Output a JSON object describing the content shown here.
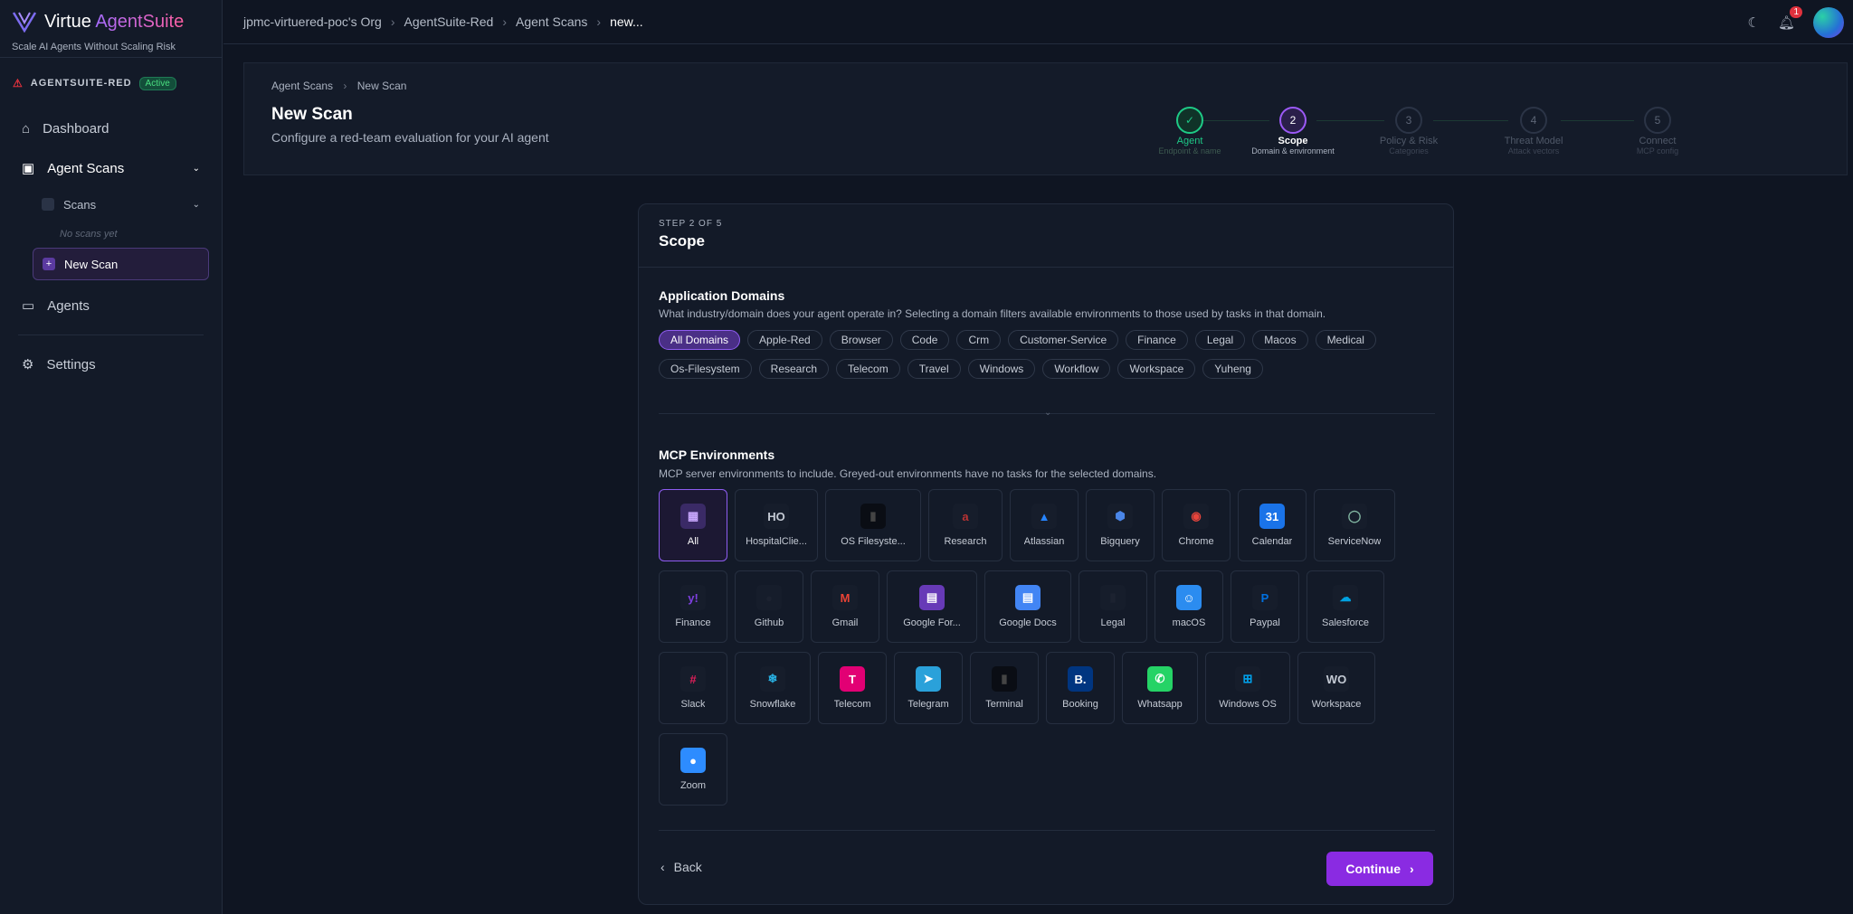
{
  "sidebar": {
    "brand_prefix": "Virtue ",
    "brand_suffix": "AgentSuite",
    "tagline": "Scale AI Agents Without Scaling Risk",
    "org_name": "AGENTSUITE-RED",
    "org_status": "Active",
    "nav": {
      "dashboard": "Dashboard",
      "agent_scans": "Agent Scans",
      "scans": "Scans",
      "no_scans": "No scans yet",
      "new_scan": "New Scan",
      "agents": "Agents",
      "settings": "Settings"
    }
  },
  "topbar": {
    "breadcrumbs": [
      "jpmc-virtuered-poc's Org",
      "AgentSuite-Red",
      "Agent Scans",
      "new..."
    ],
    "notification_count": "1"
  },
  "header": {
    "breadcrumb_parent": "Agent Scans",
    "breadcrumb_current": "New Scan",
    "title": "New Scan",
    "subtitle": "Configure a red-team evaluation for your AI agent",
    "steps": [
      {
        "num": "✓",
        "title": "Agent",
        "sub": "Endpoint & name"
      },
      {
        "num": "2",
        "title": "Scope",
        "sub": "Domain & environment"
      },
      {
        "num": "3",
        "title": "Policy & Risk",
        "sub": "Categories"
      },
      {
        "num": "4",
        "title": "Threat Model",
        "sub": "Attack vectors"
      },
      {
        "num": "5",
        "title": "Connect",
        "sub": "MCP config"
      }
    ]
  },
  "card": {
    "step_label": "STEP 2 OF 5",
    "title": "Scope",
    "domains_title": "Application Domains",
    "domains_desc": "What industry/domain does your agent operate in? Selecting a domain filters available environments to those used by tasks in that domain.",
    "domains": [
      "All Domains",
      "Apple-Red",
      "Browser",
      "Code",
      "Crm",
      "Customer-Service",
      "Finance",
      "Legal",
      "Macos",
      "Medical",
      "Os-Filesystem",
      "Research",
      "Telecom",
      "Travel",
      "Windows",
      "Workflow",
      "Workspace",
      "Yuheng"
    ],
    "env_title": "MCP Environments",
    "env_desc": "MCP server environments to include. Greyed-out environments have no tasks for the selected domains.",
    "environments": [
      {
        "label": "All",
        "icon": "grid-icon",
        "glyph": "▦",
        "bg": "#3a2a66",
        "fg": "#c9a8ff"
      },
      {
        "label": "HospitalClie...",
        "icon": "hospital-icon",
        "glyph": "HO",
        "bg": "#161d2b",
        "fg": "#c4cad4"
      },
      {
        "label": "OS Filesyste...",
        "icon": "terminal-icon",
        "glyph": "▮",
        "bg": "#0a0d14",
        "fg": "#444"
      },
      {
        "label": "Research",
        "icon": "arxiv-icon",
        "glyph": "a",
        "bg": "#161d2b",
        "fg": "#b33"
      },
      {
        "label": "Atlassian",
        "icon": "atlassian-icon",
        "glyph": "▲",
        "bg": "#161d2b",
        "fg": "#2684ff"
      },
      {
        "label": "Bigquery",
        "icon": "bigquery-icon",
        "glyph": "⬢",
        "bg": "#161d2b",
        "fg": "#4a86e8"
      },
      {
        "label": "Chrome",
        "icon": "chrome-icon",
        "glyph": "◉",
        "bg": "#161d2b",
        "fg": "#e8453c"
      },
      {
        "label": "Calendar",
        "icon": "calendar-icon",
        "glyph": "31",
        "bg": "#1a73e8",
        "fg": "#fff"
      },
      {
        "label": "ServiceNow",
        "icon": "servicenow-icon",
        "glyph": "◯",
        "bg": "#161d2b",
        "fg": "#81b5a1"
      },
      {
        "label": "Finance",
        "icon": "yahoo-icon",
        "glyph": "y!",
        "bg": "#161d2b",
        "fg": "#7e3fe0"
      },
      {
        "label": "Github",
        "icon": "github-icon",
        "glyph": "●",
        "bg": "#161d2b",
        "fg": "#1c2230"
      },
      {
        "label": "Gmail",
        "icon": "gmail-icon",
        "glyph": "M",
        "bg": "#161d2b",
        "fg": "#ea4335"
      },
      {
        "label": "Google For...",
        "icon": "google-forms-icon",
        "glyph": "▤",
        "bg": "#673ab7",
        "fg": "#fff"
      },
      {
        "label": "Google Docs",
        "icon": "google-docs-icon",
        "glyph": "▤",
        "bg": "#4285f4",
        "fg": "#fff"
      },
      {
        "label": "Legal",
        "icon": "legal-icon",
        "glyph": "▮",
        "bg": "#161d2b",
        "fg": "#1c2230"
      },
      {
        "label": "macOS",
        "icon": "finder-icon",
        "glyph": "☺",
        "bg": "#2b8cf0",
        "fg": "#fff"
      },
      {
        "label": "Paypal",
        "icon": "paypal-icon",
        "glyph": "P",
        "bg": "#161d2b",
        "fg": "#0070e0"
      },
      {
        "label": "Salesforce",
        "icon": "salesforce-icon",
        "glyph": "☁",
        "bg": "#161d2b",
        "fg": "#00a1e0"
      },
      {
        "label": "Slack",
        "icon": "slack-icon",
        "glyph": "#",
        "bg": "#161d2b",
        "fg": "#e01e5a"
      },
      {
        "label": "Snowflake",
        "icon": "snowflake-icon",
        "glyph": "❄",
        "bg": "#161d2b",
        "fg": "#29b5e8"
      },
      {
        "label": "Telecom",
        "icon": "tmobile-icon",
        "glyph": "T",
        "bg": "#e20074",
        "fg": "#fff"
      },
      {
        "label": "Telegram",
        "icon": "telegram-icon",
        "glyph": "➤",
        "bg": "#2aa1da",
        "fg": "#fff"
      },
      {
        "label": "Terminal",
        "icon": "terminal-icon",
        "glyph": "▮",
        "bg": "#0a0d14",
        "fg": "#444"
      },
      {
        "label": "Booking",
        "icon": "booking-icon",
        "glyph": "B.",
        "bg": "#003580",
        "fg": "#fff"
      },
      {
        "label": "Whatsapp",
        "icon": "whatsapp-icon",
        "glyph": "✆",
        "bg": "#25d366",
        "fg": "#fff"
      },
      {
        "label": "Windows OS",
        "icon": "windows-icon",
        "glyph": "⊞",
        "bg": "#161d2b",
        "fg": "#00a4ef"
      },
      {
        "label": "Workspace",
        "icon": "workspace-icon",
        "glyph": "WO",
        "bg": "#161d2b",
        "fg": "#c4cad4"
      },
      {
        "label": "Zoom",
        "icon": "zoom-icon",
        "glyph": "●",
        "bg": "#2d8cff",
        "fg": "#fff"
      }
    ],
    "back_label": "Back",
    "continue_label": "Continue"
  },
  "colors": {
    "accent": "#8a2be2",
    "success": "#1ec986",
    "active_badge": "#4ade80"
  }
}
